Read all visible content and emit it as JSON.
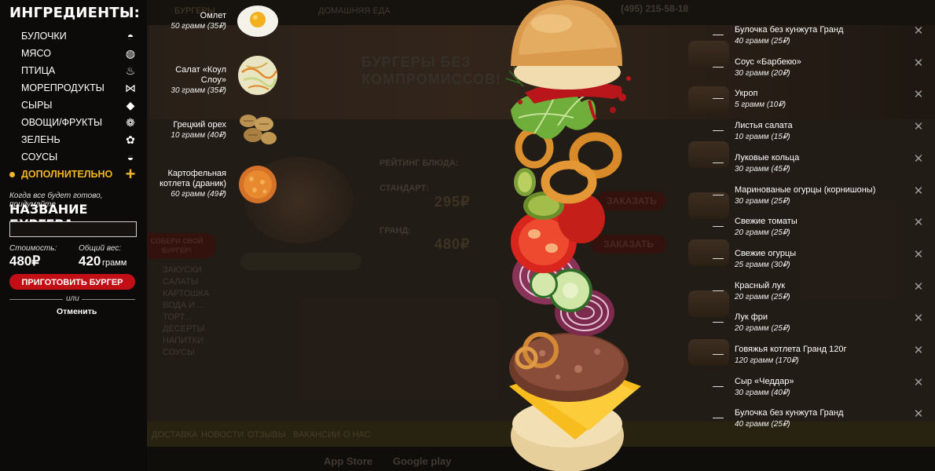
{
  "panel": {
    "title": "ИНГРЕДИЕНТЫ:",
    "categories": [
      {
        "label": "БУЛОЧКИ",
        "icon": "bun-icon"
      },
      {
        "label": "МЯСО",
        "icon": "steak-icon"
      },
      {
        "label": "ПТИЦА",
        "icon": "drumstick-icon"
      },
      {
        "label": "МОРЕПРОДУКТЫ",
        "icon": "fish-icon"
      },
      {
        "label": "СЫРЫ",
        "icon": "cheese-icon"
      },
      {
        "label": "ОВОЩИ/ФРУКТЫ",
        "icon": "vegetables-icon"
      },
      {
        "label": "ЗЕЛЕНЬ",
        "icon": "herbs-icon"
      },
      {
        "label": "СОУСЫ",
        "icon": "sauce-icon"
      },
      {
        "label": "ДОПОЛНИТЕЛЬНО",
        "icon": "plus-icon",
        "active": true
      }
    ],
    "hint": "Когда все будет готово, придумайте",
    "name_title": "НАЗВАНИЕ БУРГЕРА:",
    "name_value": "",
    "cost_label": "Стоимость:",
    "cost_value": "480₽",
    "weight_label": "Общий вес:",
    "weight_value": "420",
    "weight_unit": "грамм",
    "cook_button": "ПРИГОТОВИТЬ БУРГЕР",
    "or_text": "или",
    "cancel": "Отменить"
  },
  "choices": [
    {
      "name": "Омлет",
      "weight": "50 грамм (35₽)",
      "icon": "omelet-icon"
    },
    {
      "name": "Салат «Коул Слоу»",
      "weight": "30 грамм (35₽)",
      "icon": "coleslaw-icon"
    },
    {
      "name": "Грецкий орех",
      "weight": "10 грамм (40₽)",
      "icon": "walnut-icon"
    },
    {
      "name": "Картофельная котлета (драник)",
      "weight": "60 грамм (49₽)",
      "icon": "potato-pancake-icon"
    }
  ],
  "stack": [
    {
      "name": "Булочка без кунжута Гранд",
      "weight": "40 грамм (25₽)"
    },
    {
      "name": "Соус «Барбекю»",
      "weight": "30 грамм (20₽)"
    },
    {
      "name": "Укроп",
      "weight": "5 грамм (10₽)"
    },
    {
      "name": "Листья салата",
      "weight": "10 грамм (15₽)"
    },
    {
      "name": "Луковые кольца",
      "weight": "30 грамм (45₽)"
    },
    {
      "name": "Маринованые огурцы (корнишоны)",
      "weight": "30 грамм (25₽)"
    },
    {
      "name": "Свежие томаты",
      "weight": "20 грамм (25₽)"
    },
    {
      "name": "Свежие огурцы",
      "weight": "25 грамм (30₽)"
    },
    {
      "name": "Красный лук",
      "weight": "20 грамм (25₽)"
    },
    {
      "name": "Лук фри",
      "weight": "20 грамм (25₽)"
    },
    {
      "name": "Говяжья котлета Гранд 120г",
      "weight": "120 грамм (170₽)"
    },
    {
      "name": "Сыр «Чеддар»",
      "weight": "30 грамм (40₽)"
    },
    {
      "name": "Булочка без кунжута Гранд",
      "weight": "40 грамм (25₽)"
    }
  ],
  "background": {
    "nav": [
      "БУРГЕРЫ",
      "ДОМАШНЯЯ ЕДА"
    ],
    "phone": "(495) 215-58-18",
    "hero": "БУРГЕРЫ БЕЗ КОМПРОМИССОВ!",
    "rating_label": "РЕЙТИНГ БЛЮДА:",
    "standard": "СТАНДАРТ:",
    "standard_price": "295₽",
    "grand": "ГРАНД:",
    "grand_price": "480₽",
    "order": "ЗАКАЗАТЬ",
    "menu": [
      "ЗАКУСКИ",
      "САЛАТЫ",
      "КАРТОШКА",
      "ВОДА И ...",
      "ТОРТ...",
      "ДЕСЕРТЫ",
      "НАПИТКИ",
      "СОУСЫ"
    ],
    "collect": "СОБЕРИ СВОЙ БУРГЕР!",
    "bottom_nav": [
      "ДОСТАВКА",
      "НОВОСТИ",
      "ОТЗЫВЫ",
      "ВАКАНСИИ",
      "О НАС"
    ],
    "app_store": "App Store",
    "google_play": "Google play"
  },
  "colors": {
    "accent": "#f3b624",
    "button_red": "#c10f15",
    "panel_bg": "#0d0b0a"
  }
}
